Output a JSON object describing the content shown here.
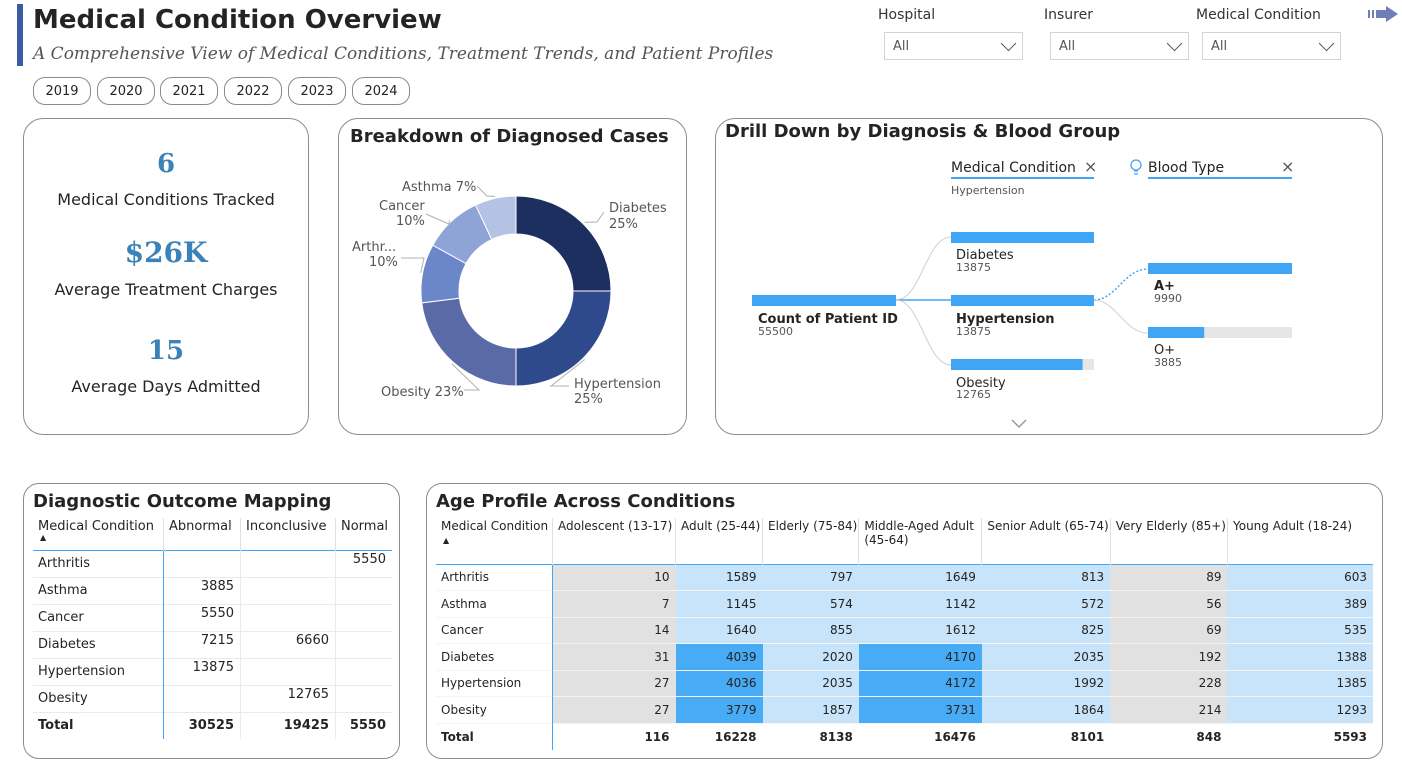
{
  "header": {
    "title": "Medical Condition Overview",
    "subtitle": "A Comprehensive View of Medical Conditions, Treatment Trends, and Patient Profiles"
  },
  "filters": [
    {
      "label": "Hospital",
      "value": "All"
    },
    {
      "label": "Insurer",
      "value": "All"
    },
    {
      "label": "Medical Condition",
      "value": "All"
    }
  ],
  "years": [
    "2019",
    "2020",
    "2021",
    "2022",
    "2023",
    "2024"
  ],
  "kpis": [
    {
      "value": "6",
      "label": "Medical Conditions Tracked"
    },
    {
      "value": "$26K",
      "label": "Average Treatment Charges"
    },
    {
      "value": "15",
      "label": "Average Days Admitted"
    }
  ],
  "donut": {
    "title": "Breakdown of Diagnosed Cases",
    "chart_data": {
      "type": "pie",
      "slices": [
        {
          "name": "Diabetes",
          "label": "Diabetes",
          "pct": 25,
          "color": "#1c2f5e"
        },
        {
          "name": "Hypertension",
          "label": "Hypertension",
          "pct": 25,
          "color": "#2f4a8c"
        },
        {
          "name": "Obesity",
          "label": "Obesity",
          "pct": 23,
          "color": "#5a6aa6"
        },
        {
          "name": "Arthritis",
          "label": "Arthr...",
          "pct": 10,
          "color": "#6b86c9"
        },
        {
          "name": "Cancer",
          "label": "Cancer",
          "pct": 10,
          "color": "#8ea4d6"
        },
        {
          "name": "Asthma",
          "label": "Asthma",
          "pct": 7,
          "color": "#b4c2e4"
        }
      ]
    }
  },
  "tree": {
    "title": "Drill Down by Diagnosis & Blood Group",
    "level1_label": "Medical Condition",
    "level1_sub": "Hypertension",
    "level2_label": "Blood Type",
    "root": {
      "label": "Count of Patient ID",
      "value": "55500"
    },
    "conditions": [
      {
        "label": "Diabetes",
        "value": "13875",
        "fill": 1.0
      },
      {
        "label": "Hypertension",
        "value": "13875",
        "fill": 1.0
      },
      {
        "label": "Obesity",
        "value": "12765",
        "fill": 0.92
      }
    ],
    "blood": [
      {
        "label": "A+",
        "value": "9990",
        "fill": 1.0
      },
      {
        "label": "O+",
        "value": "3885",
        "fill": 0.39
      }
    ]
  },
  "outcome": {
    "title": "Diagnostic Outcome Mapping",
    "columns": [
      "Medical Condition",
      "Abnormal",
      "Inconclusive",
      "Normal"
    ],
    "rows": [
      [
        "Arthritis",
        "",
        "",
        "5550"
      ],
      [
        "Asthma",
        "3885",
        "",
        ""
      ],
      [
        "Cancer",
        "5550",
        "",
        ""
      ],
      [
        "Diabetes",
        "7215",
        "6660",
        ""
      ],
      [
        "Hypertension",
        "13875",
        "",
        ""
      ],
      [
        "Obesity",
        "",
        "12765",
        ""
      ]
    ],
    "total": [
      "Total",
      "30525",
      "19425",
      "5550"
    ]
  },
  "age": {
    "title": "Age Profile Across Conditions",
    "columns": [
      "Medical Condition",
      "Adolescent (13-17)",
      "Adult (25-44)",
      "Elderly (75-84)",
      "Middle-Aged Adult (45-64)",
      "Senior Adult (65-74)",
      "Very Elderly (85+)",
      "Young Adult (18-24)"
    ],
    "rows": [
      [
        "Arthritis",
        "10",
        "1589",
        "797",
        "1649",
        "813",
        "89",
        "603"
      ],
      [
        "Asthma",
        "7",
        "1145",
        "574",
        "1142",
        "572",
        "56",
        "389"
      ],
      [
        "Cancer",
        "14",
        "1640",
        "855",
        "1612",
        "825",
        "69",
        "535"
      ],
      [
        "Diabetes",
        "31",
        "4039",
        "2020",
        "4170",
        "2035",
        "192",
        "1388"
      ],
      [
        "Hypertension",
        "27",
        "4036",
        "2035",
        "4172",
        "1992",
        "228",
        "1385"
      ],
      [
        "Obesity",
        "27",
        "3779",
        "1857",
        "3731",
        "1864",
        "214",
        "1293"
      ]
    ],
    "total": [
      "Total",
      "116",
      "16228",
      "8138",
      "16476",
      "8101",
      "848",
      "5593"
    ]
  },
  "colors": {
    "accent": "#3b5ba5",
    "kpi": "#3b82b8",
    "tree_bar": "#41a5f5",
    "heat_low": "#e1e1e1",
    "heat_mid": "#c7e4fb",
    "heat_high": "#47abf5"
  }
}
